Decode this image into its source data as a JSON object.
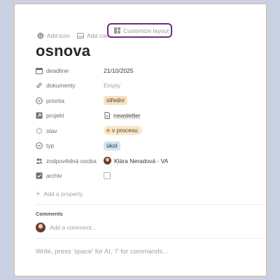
{
  "top_actions": {
    "add_icon": "Add icon",
    "add_cover": "Add cover",
    "customize_layout": "Customize layout"
  },
  "page_title": "osnova",
  "properties": [
    {
      "key": "deadline",
      "icon": "calendar-icon",
      "value": "21/10/2025"
    },
    {
      "key": "dokumenty",
      "icon": "link-icon",
      "value": "Empty"
    },
    {
      "key": "priorita",
      "icon": "select-icon",
      "value": "střední",
      "color": "#f6e3c6"
    },
    {
      "key": "projekt",
      "icon": "relation-icon",
      "value": "newsletter"
    },
    {
      "key": "stav",
      "icon": "status-icon",
      "value": "v procesu",
      "color": "#f8e7c9"
    },
    {
      "key": "typ",
      "icon": "select-icon",
      "value": "úkol",
      "color": "#d3e5ef"
    },
    {
      "key": "zodpovědná osoba",
      "icon": "people-icon",
      "value": "Klára Neradová - VA"
    },
    {
      "key": "archiv",
      "icon": "checkbox-icon",
      "value": ""
    }
  ],
  "add_property": "Add a property",
  "comments": {
    "label": "Comments",
    "placeholder": "Add a comment..."
  },
  "editor_hint": "Write, press 'space' for AI, '/' for commands...",
  "colors": {
    "accent_outline": "#6b2c7e",
    "background": "#c9d1e3"
  }
}
